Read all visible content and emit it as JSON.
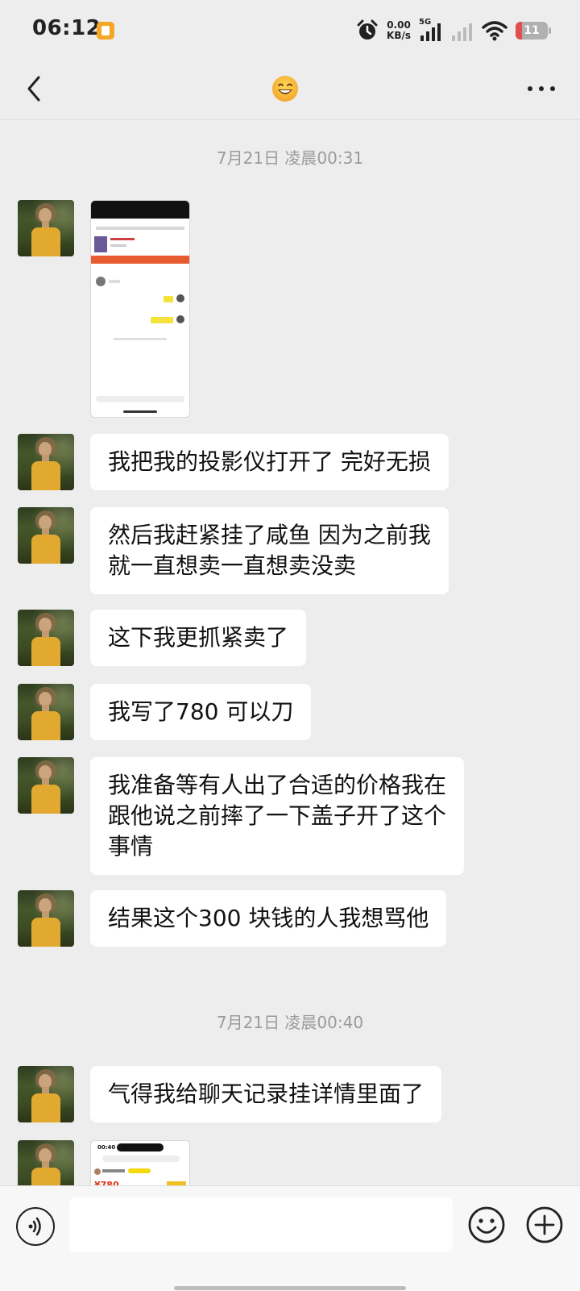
{
  "status_bar": {
    "time": "06:12",
    "net_speed_value": "0.00",
    "net_speed_unit": "KB/s",
    "network": "5G",
    "battery": "11",
    "icons": [
      "notification-badge-icon",
      "alarm-icon",
      "signal-icon",
      "wifi-icon",
      "battery-icon"
    ]
  },
  "nav": {
    "back_icon": "chevron-left-icon",
    "title_icon": "smiling-face-emoji",
    "more_icon": "more-dots-icon"
  },
  "chat": {
    "time_1": "7月21日 凌晨00:31",
    "time_2": "7月21日 凌晨00:40",
    "messages": [
      {
        "type": "image",
        "content": "chat-screenshot"
      },
      {
        "type": "text",
        "text": "我把我的投影仪打开了 完好无损"
      },
      {
        "type": "text",
        "lines": [
          "然后我赶紧挂了咸鱼 因为之前我",
          "就一直想卖一直想卖没卖"
        ]
      },
      {
        "type": "text",
        "text": "这下我更抓紧卖了"
      },
      {
        "type": "text",
        "text": "我写了780 可以刀"
      },
      {
        "type": "text",
        "lines": [
          "我准备等有人出了合适的价格我在",
          "跟他说之前摔了一下盖子开了这个",
          "事情"
        ]
      },
      {
        "type": "text",
        "text": "结果这个300 块钱的人我想骂他"
      },
      {
        "type": "text",
        "text": "气得我给聊天记录挂详情里面了"
      },
      {
        "type": "image",
        "content": "listing-screenshot",
        "visible_text": {
          "time": "00:40",
          "price": "¥780"
        }
      }
    ]
  },
  "input_bar": {
    "voice_icon": "voice-icon",
    "emoji_icon": "emoji-icon",
    "plus_icon": "plus-circle-icon"
  },
  "colors": {
    "background": "#ededed",
    "bubble": "#ffffff",
    "timestamp": "#9a9a9a",
    "text": "#111111"
  }
}
